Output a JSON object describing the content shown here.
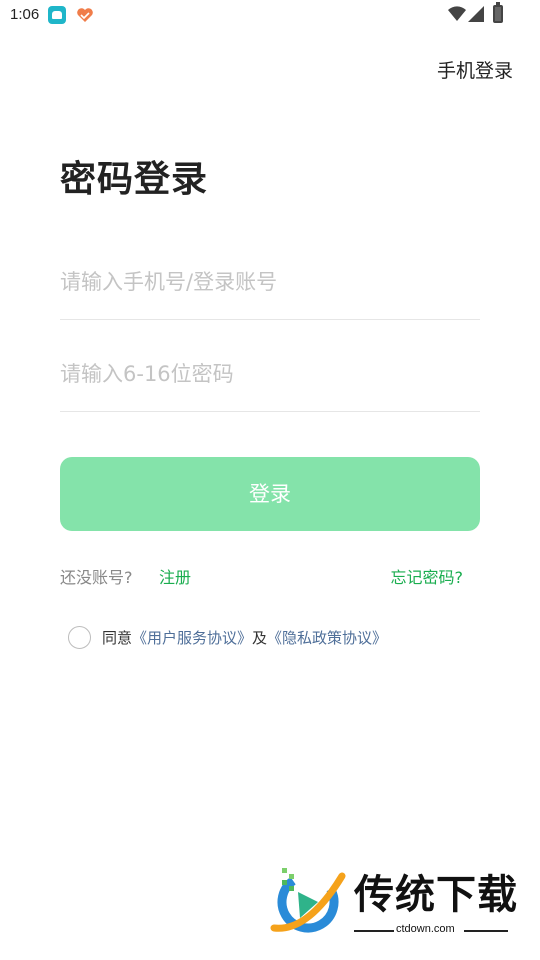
{
  "status_bar": {
    "time": "1:06",
    "icons": [
      "app-icon",
      "app-heart-icon",
      "wifi-icon",
      "signal-icon",
      "battery-icon"
    ]
  },
  "header": {
    "switch_link": "手机登录"
  },
  "main": {
    "title": "密码登录",
    "account_input": {
      "value": "",
      "placeholder": "请输入手机号/登录账号"
    },
    "password_input": {
      "value": "",
      "placeholder": "请输入6-16位密码"
    },
    "login_button": "登录",
    "no_account_text": "还没账号?",
    "register_link": "注册",
    "forgot_link": "忘记密码?",
    "agreement": {
      "prefix": "同意",
      "user_agreement": "《用户服务协议》",
      "conjunction": "及",
      "privacy_policy": "《隐私政策协议》",
      "checked": false
    }
  },
  "watermark": {
    "brand": "传统下载",
    "domain": "ctdown.com"
  },
  "colors": {
    "accent_green": "#1aad4f",
    "button_disabled_green": "#84e3aa",
    "link_blue": "#4f6f99",
    "placeholder_gray": "#c4c4c4"
  }
}
